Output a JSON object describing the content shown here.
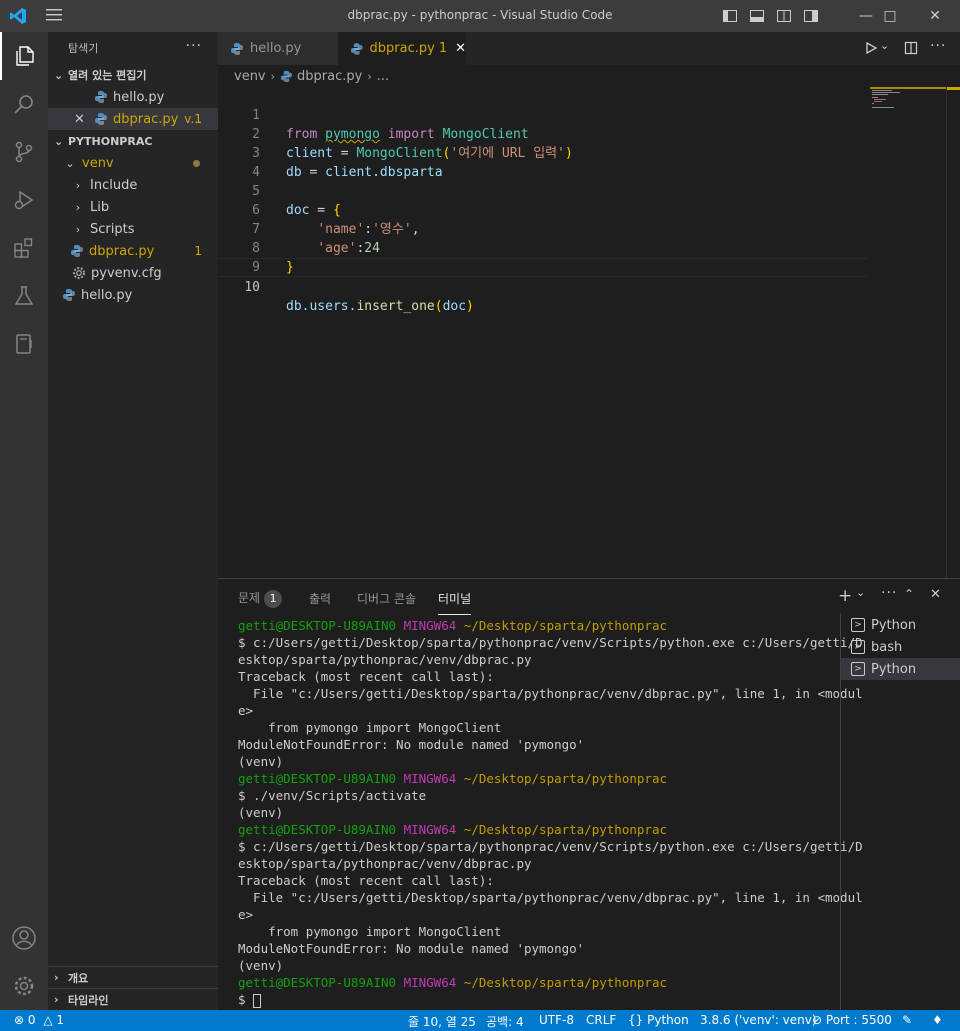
{
  "window": {
    "title": "dbprac.py - pythonprac - Visual Studio Code"
  },
  "sidebar": {
    "header": "탐색기",
    "open_editors": {
      "title": "열려 있는 편집기",
      "items": [
        {
          "label": "hello.py"
        },
        {
          "label": "dbprac.py",
          "suffix": "v...",
          "badge": "1"
        }
      ]
    },
    "project": {
      "title": "PYTHONPRAC",
      "items": [
        {
          "label": "venv"
        },
        {
          "label": "Include"
        },
        {
          "label": "Lib"
        },
        {
          "label": "Scripts"
        },
        {
          "label": "dbprac.py",
          "badge": "1"
        },
        {
          "label": "pyvenv.cfg"
        },
        {
          "label": "hello.py"
        }
      ]
    },
    "outline": "개요",
    "timeline": "타임라인"
  },
  "tabs": [
    {
      "label": "hello.py"
    },
    {
      "label": "dbprac.py",
      "badge": "1"
    }
  ],
  "breadcrumb": {
    "folder": "venv",
    "file": "dbprac.py",
    "more": "..."
  },
  "editor": {
    "line_numbers": [
      "1",
      "2",
      "3",
      "4",
      "5",
      "6",
      "7",
      "8",
      "9",
      "10"
    ],
    "code": {
      "l1": {
        "from": "from",
        "mod": "pymongo",
        "imp": "import",
        "cls": "MongoClient"
      },
      "l2": {
        "var": "client",
        "eq": " = ",
        "cls": "MongoClient",
        "open": "(",
        "str": "'여기에 URL 입력'",
        "close": ")"
      },
      "l3": {
        "var": "db",
        "eq": " = ",
        "obj": "client",
        "attr": ".dbsparta"
      },
      "l5": {
        "var": "doc",
        "eq": " = ",
        "brace": "{"
      },
      "l6": {
        "key": "'name'",
        "colon": ":",
        "val": "'영수'",
        "comma": ","
      },
      "l7": {
        "key": "'age'",
        "colon": ":",
        "val": "24"
      },
      "l8": {
        "brace": "}"
      },
      "l10": {
        "obj": "db",
        "attr": ".users.",
        "fn": "insert_one",
        "open": "(",
        "arg": "doc",
        "close": ")"
      }
    }
  },
  "panel": {
    "tabs": {
      "problems": "문제",
      "problems_count": "1",
      "output": "출력",
      "debug": "디버그 콘솔",
      "terminal": "터미널"
    },
    "terminals": [
      {
        "label": "Python"
      },
      {
        "label": "bash"
      },
      {
        "label": "Python"
      }
    ],
    "prompt": {
      "user": "getti@DESKTOP-U89AIN0",
      "host": "MINGW64",
      "path": "~/Desktop/sparta/pythonprac"
    },
    "lines": {
      "cmd1a": "$ c:/Users/getti/Desktop/sparta/pythonprac/venv/Scripts/python.exe c:/Users/getti/D",
      "cmd1b": "esktop/sparta/pythonprac/venv/dbprac.py",
      "tb": "Traceback (most recent call last):",
      "file_a": "  File \"c:/Users/getti/Desktop/sparta/pythonprac/venv/dbprac.py\", line 1, in <modul",
      "file_b": "e>",
      "src": "    from pymongo import MongoClient",
      "err": "ModuleNotFoundError: No module named 'pymongo'",
      "venv": "(venv)",
      "activate": "$ ./venv/Scripts/activate",
      "dollar": "$ "
    }
  },
  "statusbar": {
    "errors": "0",
    "warnings": "1",
    "position": "줄 10, 열 25",
    "spaces": "공백: 4",
    "encoding": "UTF-8",
    "eol": "CRLF",
    "language": "Python",
    "interpreter": "3.8.6 ('venv': venv)",
    "port": "Port : 5500"
  },
  "colors": {
    "accent": "#007acc",
    "warning": "#cca700",
    "prompt_user": "#13a10e",
    "prompt_host": "#c239b3",
    "prompt_path": "#c19c00"
  },
  "icons": [
    "vscode-logo",
    "menu-icon",
    "files-icon",
    "search-icon",
    "source-control-icon",
    "run-debug-icon",
    "extensions-icon",
    "testing-icon",
    "remote-icon",
    "account-icon",
    "gear-icon",
    "python-file-icon",
    "settings-file-icon",
    "close-icon",
    "chevron-icon",
    "run-icon",
    "split-icon",
    "more-icon",
    "plus-icon",
    "maximize-icon",
    "terminal-icon",
    "bell-icon",
    "feedback-icon"
  ]
}
